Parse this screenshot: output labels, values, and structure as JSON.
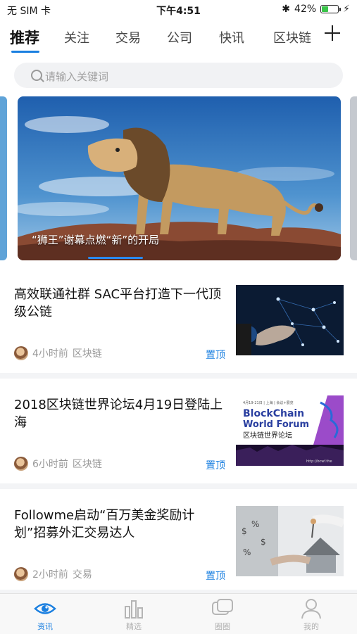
{
  "status_bar": {
    "carrier": "无 SIM 卡",
    "time": "下午4:51",
    "battery": "42%",
    "battery_level": 0.42
  },
  "tabs": [
    {
      "label": "推荐",
      "active": true
    },
    {
      "label": "关注"
    },
    {
      "label": "交易"
    },
    {
      "label": "公司"
    },
    {
      "label": "快讯"
    },
    {
      "label": "区块链"
    }
  ],
  "search": {
    "placeholder": "请输入关键词"
  },
  "banner": {
    "caption": "“狮王”谢幕点燃“新”的开局"
  },
  "articles": [
    {
      "title": "高效联通社群 SAC平台打造下一代顶级公链",
      "time": "4小时前",
      "category": "区块链",
      "pin": "置顶",
      "thumb": "network-image"
    },
    {
      "title": "2018区块链世界论坛4月19日登陆上海",
      "time": "6小时前",
      "category": "区块链",
      "pin": "置顶",
      "thumb": "blockchain-forum-image",
      "thumb_text": {
        "top": "4月19-21日 | 上海 | 会议+展览",
        "line1": "BlockChain",
        "line2": "World Forum",
        "cn": "区块链世界论坛",
        "url": "http://bcwf.the"
      }
    },
    {
      "title": "Followme启动“百万美金奖励计划”招募外汇交易达人",
      "time": "2小时前",
      "category": "交易",
      "pin": "置顶",
      "thumb": "money-house-image"
    }
  ],
  "tab_bar": [
    {
      "label": "资讯",
      "icon": "eye-icon",
      "active": true
    },
    {
      "label": "精选",
      "icon": "bar-chart-icon"
    },
    {
      "label": "圈圈",
      "icon": "chat-bubbles-icon"
    },
    {
      "label": "我的",
      "icon": "user-icon"
    }
  ],
  "colors": {
    "accent": "#1a7fe0",
    "battery": "#3ac54a"
  }
}
